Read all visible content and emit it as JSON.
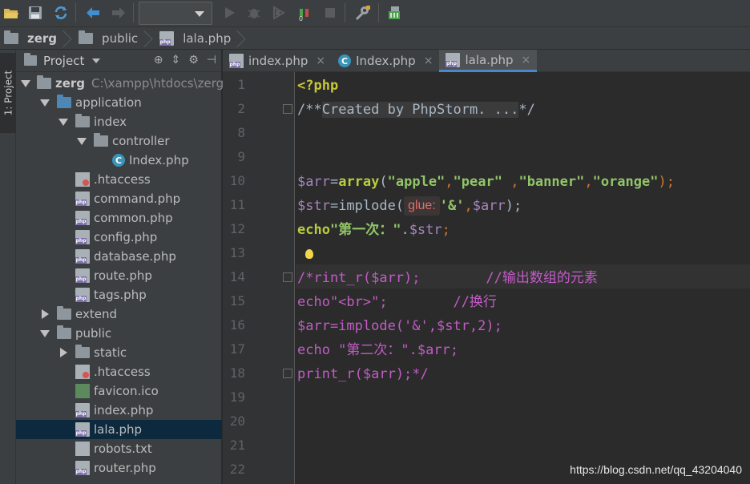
{
  "breadcrumb": [
    {
      "label": "zerg",
      "icon": "folder-icon"
    },
    {
      "label": "public",
      "icon": "folder-icon"
    },
    {
      "label": "lala.php",
      "icon": "php-file-icon"
    }
  ],
  "sidebar": {
    "stripe_label": "1: Project"
  },
  "project": {
    "title": "Project",
    "tree": [
      {
        "label": "zerg",
        "extra": "C:\\xampp\\htdocs\\zerg",
        "type": "folder",
        "state": "open",
        "depth": 0
      },
      {
        "label": "application",
        "type": "folder-blue",
        "state": "open",
        "depth": 1
      },
      {
        "label": "index",
        "type": "folder",
        "state": "open",
        "depth": 2
      },
      {
        "label": "controller",
        "type": "folder",
        "state": "open",
        "depth": 3
      },
      {
        "label": "Index.php",
        "type": "class",
        "state": "none",
        "depth": 4
      },
      {
        "label": ".htaccess",
        "type": "htaccess",
        "state": "none",
        "depth": 2
      },
      {
        "label": "command.php",
        "type": "php",
        "state": "none",
        "depth": 2
      },
      {
        "label": "common.php",
        "type": "php",
        "state": "none",
        "depth": 2
      },
      {
        "label": "config.php",
        "type": "php",
        "state": "none",
        "depth": 2
      },
      {
        "label": "database.php",
        "type": "php",
        "state": "none",
        "depth": 2
      },
      {
        "label": "route.php",
        "type": "php",
        "state": "none",
        "depth": 2
      },
      {
        "label": "tags.php",
        "type": "php",
        "state": "none",
        "depth": 2
      },
      {
        "label": "extend",
        "type": "folder",
        "state": "closed",
        "depth": 1
      },
      {
        "label": "public",
        "type": "folder",
        "state": "open",
        "depth": 1
      },
      {
        "label": "static",
        "type": "folder",
        "state": "closed",
        "depth": 2
      },
      {
        "label": ".htaccess",
        "type": "htaccess",
        "state": "none",
        "depth": 2
      },
      {
        "label": "favicon.ico",
        "type": "image",
        "state": "none",
        "depth": 2
      },
      {
        "label": "index.php",
        "type": "php",
        "state": "none",
        "depth": 2
      },
      {
        "label": "lala.php",
        "type": "php",
        "state": "none",
        "depth": 2,
        "selected": true
      },
      {
        "label": "robots.txt",
        "type": "text",
        "state": "none",
        "depth": 2
      },
      {
        "label": "router.php",
        "type": "php",
        "state": "none",
        "depth": 2
      }
    ]
  },
  "tabs": [
    {
      "label": "index.php",
      "icon": "php-file-icon",
      "close": "×",
      "active": false
    },
    {
      "label": "Index.php",
      "icon": "class-icon",
      "close": "×",
      "active": false
    },
    {
      "label": "lala.php",
      "icon": "php-file-icon",
      "close": "×",
      "active": true
    }
  ],
  "editor": {
    "line_numbers": [
      "1",
      "2",
      "8",
      "9",
      "10",
      "11",
      "12",
      "13",
      "14",
      "15",
      "16",
      "17",
      "18",
      "19",
      "20",
      "21",
      "22"
    ],
    "lines": {
      "l1": "<?php",
      "l2_a": "/**",
      "l2_fold": "Created by PhpStorm. ...",
      "l2_b": "*/",
      "l10": {
        "a": "$arr",
        "b": "=",
        "c": "array",
        "d": "(",
        "e": "\"apple\"",
        "f": ",",
        "g": "\"pear\"",
        "h": " ,",
        "i": "\"banner\"",
        "j": ",",
        "k": "\"orange\"",
        "l": ");"
      },
      "l11": {
        "a": "$str",
        "b": "=implode(",
        "hint": "glue:",
        "c": "'&'",
        ",": ",",
        "d": "$arr",
        "e": ");"
      },
      "l12": {
        "a": "echo",
        "b": "\"第一次：\"",
        "c": ".",
        "d": "$str",
        ";": ";"
      },
      "l14": "/*rint_r($arr);        //输出数组的元素",
      "l15": "echo\"<br>\";        //换行",
      "l16": "$arr=implode('&',$str,2);",
      "l17": "echo \"第二次：\".$arr;",
      "l18": "print_r($arr);*/"
    }
  },
  "watermark": "https://blog.csdn.net/qq_43204040"
}
